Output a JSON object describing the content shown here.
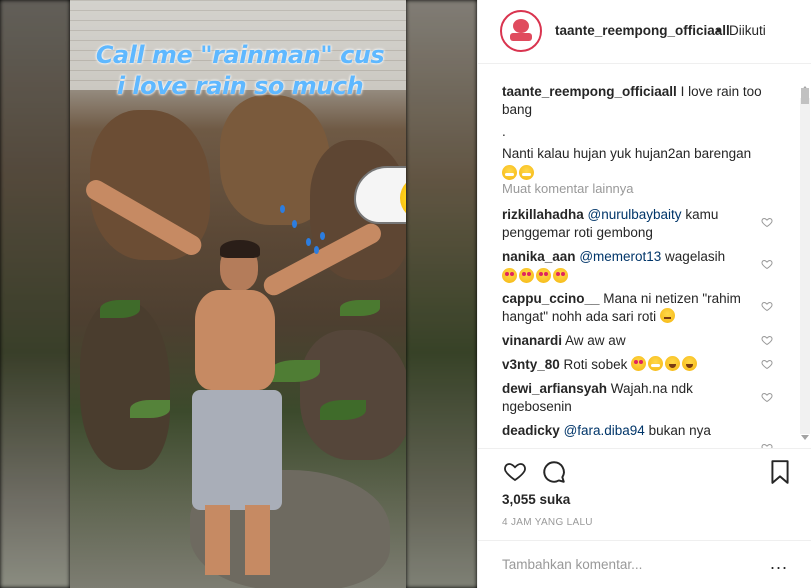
{
  "media": {
    "sticker_text_line1": "Call me \"rainman\" cus",
    "sticker_text_line2": "i love rain so much"
  },
  "header": {
    "username": "taante_reempong_officiaall",
    "separator": "•",
    "follow_status": "Diikuti"
  },
  "caption": {
    "username": "taante_reempong_officiaall",
    "line1": " I love rain too bang",
    "line2": ".",
    "line3": "Nanti kalau hujan yuk hujan2an barengan"
  },
  "load_more": "Muat komentar lainnya",
  "comments": [
    {
      "username": "rizkillahadha",
      "mention": "@nurulbaybaity",
      "text": " kamu penggemar roti gembong"
    },
    {
      "username": "nanika_aan",
      "mention": "@memerot13",
      "text": " wagelasih"
    },
    {
      "username": "cappu_ccino__",
      "mention": "",
      "text": " Mana ni netizen \"rahim hangat\" nohh ada sari roti"
    },
    {
      "username": "vinanardi",
      "mention": "",
      "text": " Aw aw aw"
    },
    {
      "username": "v3nty_80",
      "mention": "",
      "text": " Roti sobek"
    },
    {
      "username": "dewi_arfiansyah",
      "mention": "",
      "text": " Wajah.na ndk ngebosenin"
    },
    {
      "username": "deadicky",
      "mention": "@fara.diba94",
      "text": " bukan nya"
    }
  ],
  "likes": "3,055 suka",
  "timestamp": "4 JAM YANG LALU",
  "add_comment": {
    "placeholder": "Tambahkan komentar..."
  },
  "more_options": "...",
  "icons": [
    "heart-icon",
    "comment-icon",
    "bookmark-icon",
    "like-comment-icon",
    "more-options-icon"
  ],
  "colors": {
    "link": "#003569",
    "muted": "#999999",
    "text": "#262626",
    "sticker": "#5fb8ff",
    "story_ring": "#d9344f"
  }
}
